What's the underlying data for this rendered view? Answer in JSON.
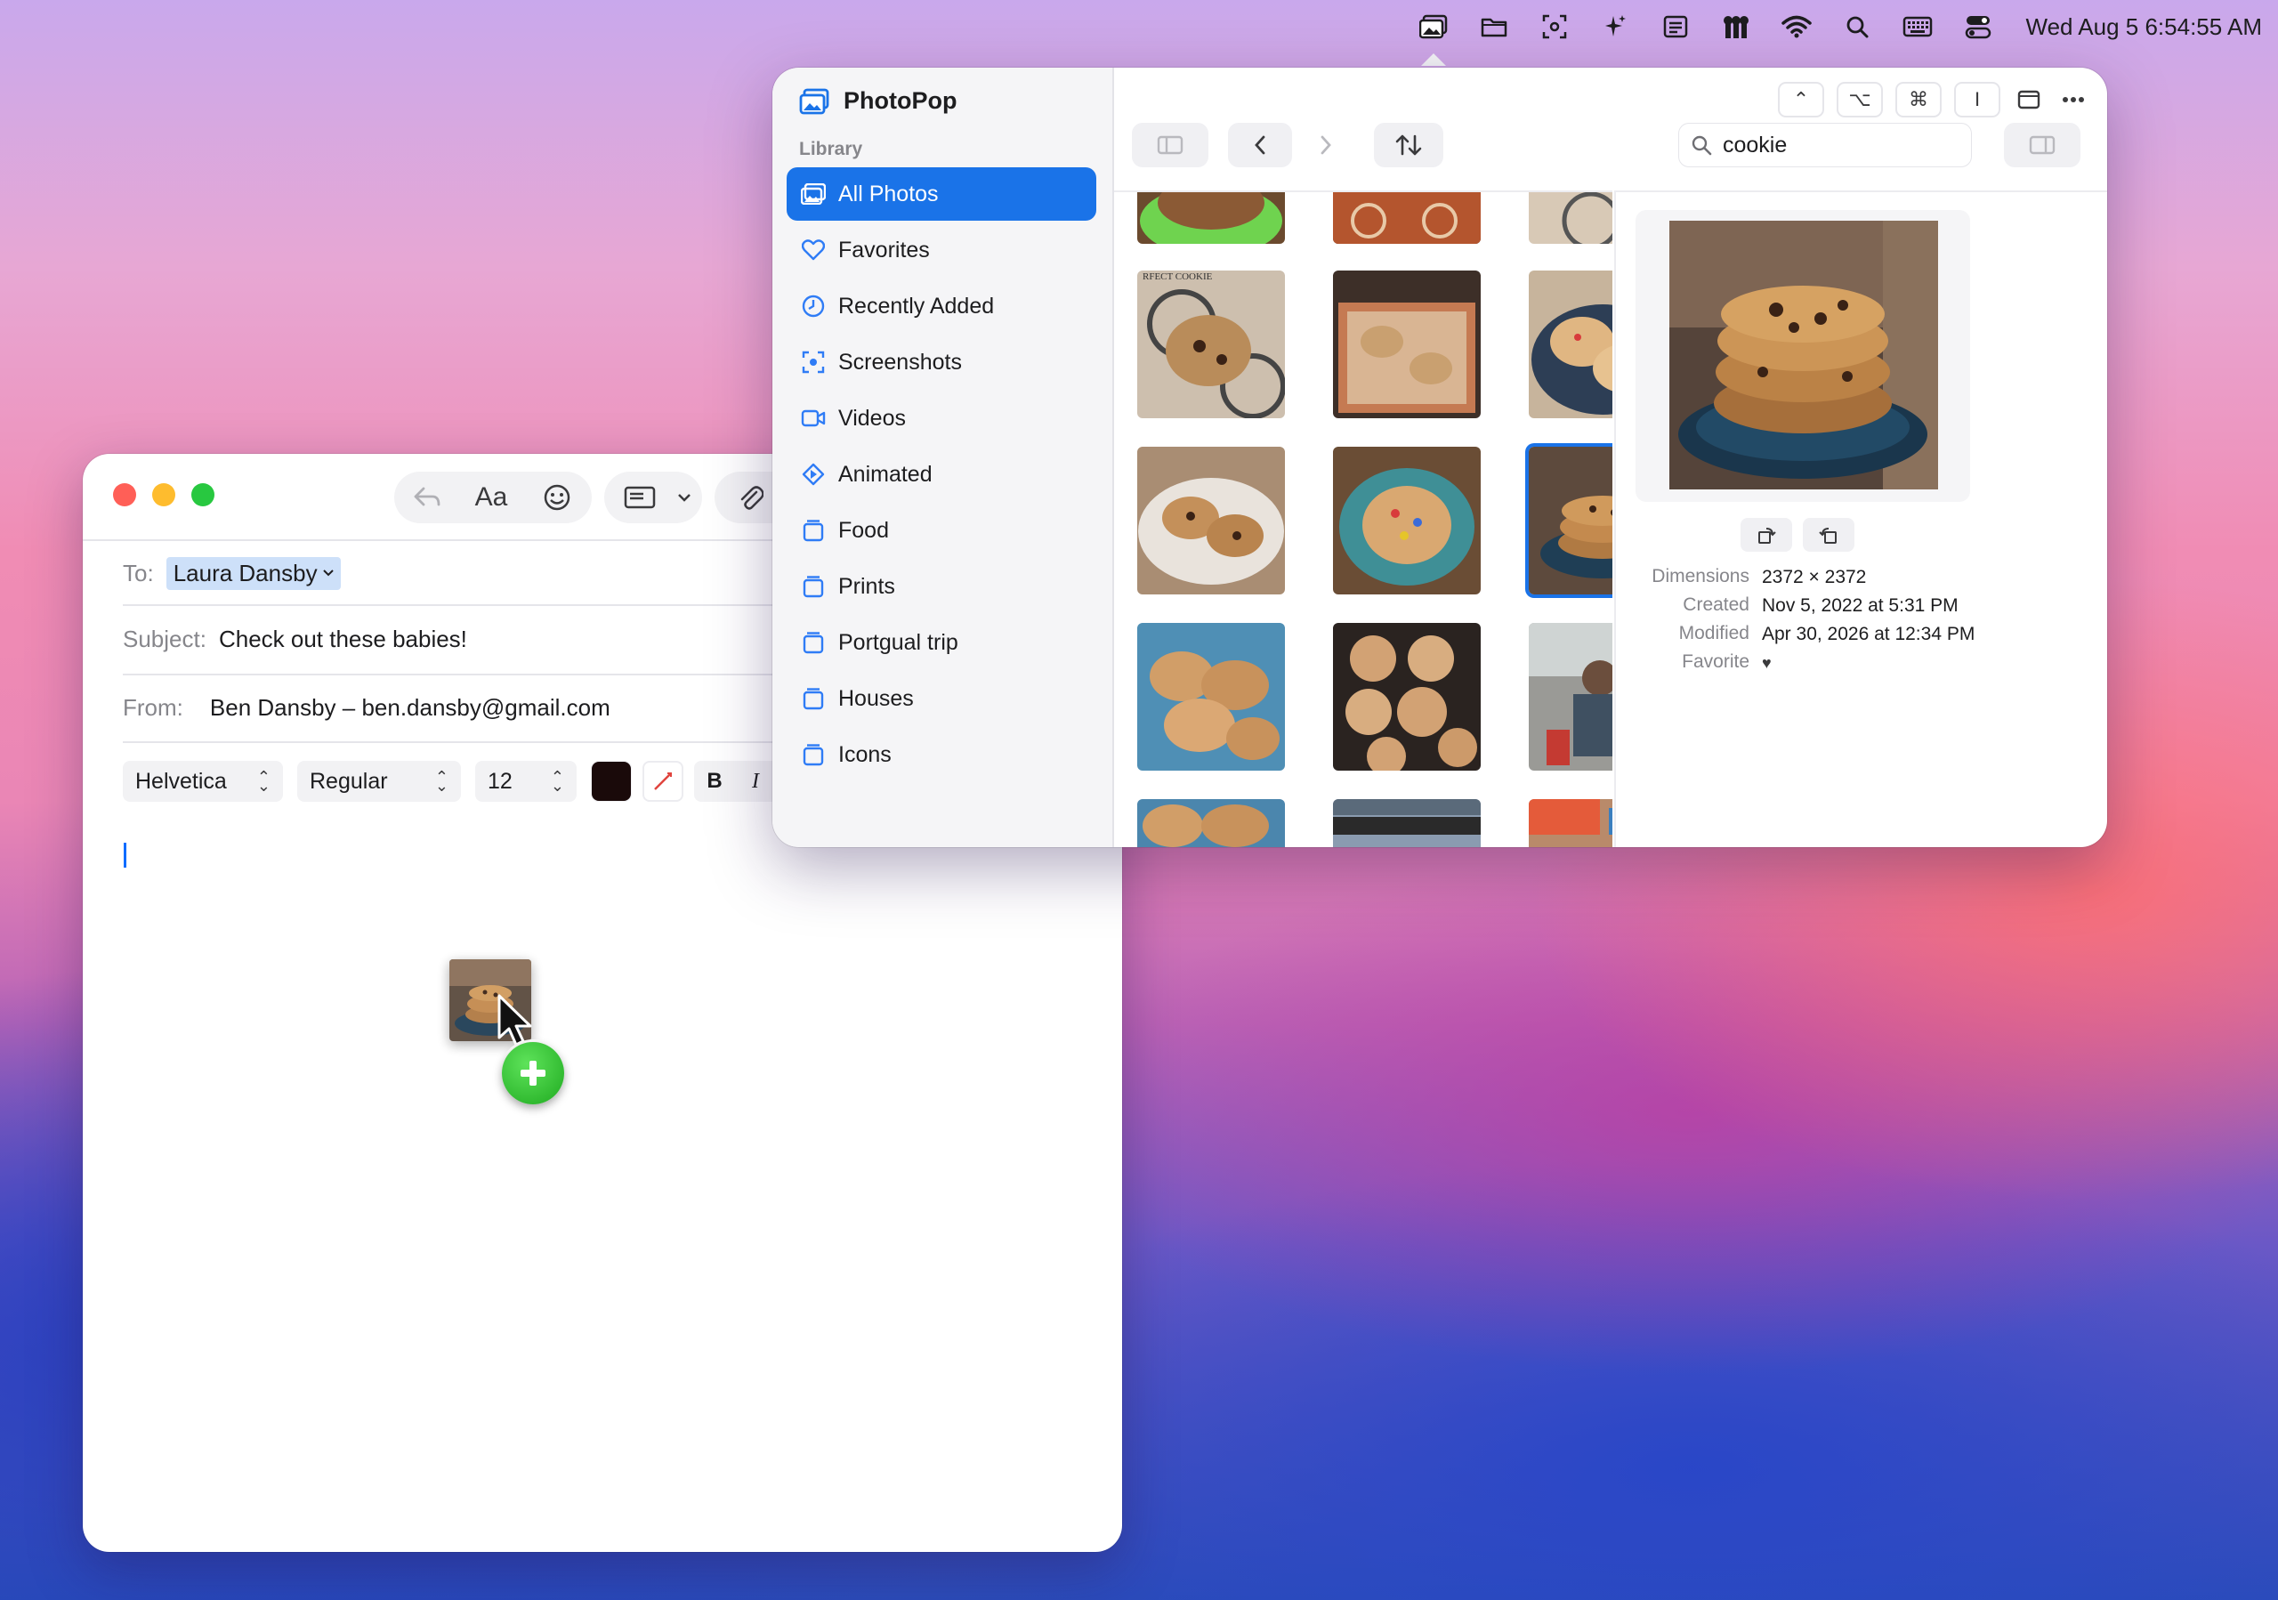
{
  "menubar": {
    "clock": "Wed Aug 5  6:54:55 AM",
    "icons": [
      "photopop-icon",
      "folder-icon",
      "screenshot-icon",
      "sparkle-icon",
      "reader-icon",
      "keys-icon",
      "wifi-icon",
      "search-icon",
      "keyboard-icon",
      "control-center-icon"
    ]
  },
  "mail": {
    "to_label": "To:",
    "to_recipient": "Laura Dansby",
    "subject_label": "Subject:",
    "subject": "Check out these babies!",
    "from_label": "From:",
    "from": "Ben Dansby – ben.dansby@gmail.com",
    "format": {
      "font": "Helvetica",
      "weight": "Regular",
      "size": "12",
      "color": "#1a0a0a",
      "bold": "B",
      "italic": "I",
      "text_size_label": "Aa"
    }
  },
  "photopop": {
    "title": "PhotoPop",
    "section": "Library",
    "nav": [
      {
        "label": "All Photos",
        "icon": "photos-icon",
        "selected": true
      },
      {
        "label": "Favorites",
        "icon": "heart-icon"
      },
      {
        "label": "Recently Added",
        "icon": "clock-icon"
      },
      {
        "label": "Screenshots",
        "icon": "screenshot-icon"
      },
      {
        "label": "Videos",
        "icon": "video-icon"
      },
      {
        "label": "Animated",
        "icon": "animated-icon"
      },
      {
        "label": "Food",
        "icon": "album-icon"
      },
      {
        "label": "Prints",
        "icon": "album-icon"
      },
      {
        "label": "Portgual trip",
        "icon": "album-icon"
      },
      {
        "label": "Houses",
        "icon": "album-icon"
      },
      {
        "label": "Icons",
        "icon": "album-icon"
      }
    ],
    "search_value": "cookie",
    "window_keys": [
      "⌃",
      "⌥",
      "⌘",
      "I"
    ],
    "info": {
      "dimensions_label": "Dimensions",
      "dimensions": "2372 × 2372",
      "created_label": "Created",
      "created": "Nov 5, 2022 at 5:31 PM",
      "modified_label": "Modified",
      "modified": "Apr 30, 2026 at 12:34 PM",
      "favorite_label": "Favorite",
      "favorite": "♥"
    },
    "accent": "#1a73e8"
  }
}
